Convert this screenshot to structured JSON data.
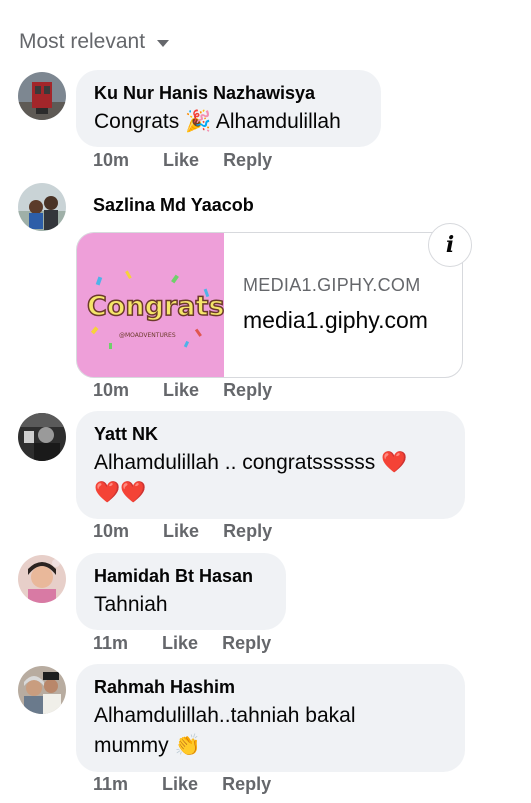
{
  "sort": {
    "label": "Most relevant"
  },
  "comments": [
    {
      "name": "Ku Nur Hanis Nazhawisya",
      "text": "Congrats 🎉 Alhamdulillah",
      "time": "10m",
      "like": "Like",
      "reply": "Reply"
    },
    {
      "name": "Sazlina Md Yaacob",
      "time": "10m",
      "like": "Like",
      "reply": "Reply",
      "link": {
        "domain": "MEDIA1.GIPHY.COM",
        "title": "media1.giphy.com",
        "gif_text": "Congrats",
        "gif_caption": "@MOADVENTURES",
        "info": "i"
      }
    },
    {
      "name": "Yatt NK",
      "text_line1": "Alhamdulillah .. congratssssss ❤️",
      "text_line2": "❤️❤️",
      "time": "10m",
      "like": "Like",
      "reply": "Reply"
    },
    {
      "name": "Hamidah Bt Hasan",
      "text": "Tahniah",
      "time": "11m",
      "like": "Like",
      "reply": "Reply"
    },
    {
      "name": "Rahmah Hashim",
      "text_line1": "Alhamdulillah..tahniah bakal",
      "text_line2": "mummy 👏",
      "time": "11m",
      "like": "Like",
      "reply": "Reply"
    }
  ],
  "colors": {
    "bubble": "#f0f2f5",
    "meta": "#65676b",
    "giphy_bg": "#ee9fd9",
    "heart": "#e0245e"
  }
}
